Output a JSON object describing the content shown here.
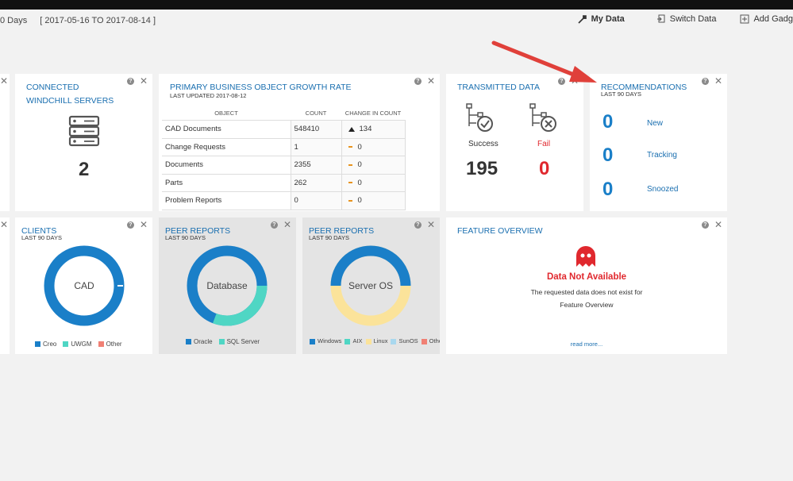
{
  "header": {
    "days_label": "0 Days",
    "date_range": "[ 2017-05-16 TO 2017-08-14 ]",
    "my_data": "My Data",
    "switch_data": "Switch Data",
    "add_gadget": "Add Gadg"
  },
  "connected": {
    "title_line1": "CONNECTED",
    "title_line2": "WINDCHILL SERVERS",
    "count": "2"
  },
  "growth": {
    "title": "PRIMARY BUSINESS OBJECT GROWTH RATE",
    "updated": "LAST UPDATED  2017-08-12",
    "columns": [
      "OBJECT",
      "COUNT",
      "CHANGE IN COUNT"
    ],
    "rows": [
      {
        "object": "CAD Documents",
        "count": "548410",
        "change": "134",
        "trend": "up"
      },
      {
        "object": "Change Requests",
        "count": "1",
        "change": "0",
        "trend": "flat"
      },
      {
        "object": "Documents",
        "count": "2355",
        "change": "0",
        "trend": "flat"
      },
      {
        "object": "Parts",
        "count": "262",
        "change": "0",
        "trend": "flat"
      },
      {
        "object": "Problem Reports",
        "count": "0",
        "change": "0",
        "trend": "flat"
      }
    ]
  },
  "transmitted": {
    "title": "TRANSMITTED DATA",
    "success_label": "Success",
    "success_count": "195",
    "fail_label": "Fail",
    "fail_count": "0"
  },
  "recommendations": {
    "title": "RECOMMENDATIONS",
    "subtitle": "LAST 90 DAYS",
    "items": [
      {
        "count": "0",
        "label": "New"
      },
      {
        "count": "0",
        "label": "Tracking"
      },
      {
        "count": "0",
        "label": "Snoozed"
      }
    ]
  },
  "clients": {
    "title": "CLIENTS",
    "subtitle": "LAST 90 DAYS",
    "center": "CAD",
    "legend": [
      "Creo",
      "UWGM",
      "Other"
    ]
  },
  "peer_db": {
    "title": "PEER REPORTS",
    "subtitle": "LAST 90 DAYS",
    "center": "Database",
    "legend": [
      "Oracle",
      "SQL Server"
    ]
  },
  "peer_os": {
    "title": "PEER REPORTS",
    "subtitle": "LAST 90 DAYS",
    "center": "Server OS",
    "legend": [
      "Windows",
      "AIX",
      "Linux",
      "SunOS",
      "Other"
    ]
  },
  "feature": {
    "title": "FEATURE OVERVIEW",
    "nodata_title": "Data Not Available",
    "nodata_line1": "The requested data does not exist for",
    "nodata_line2": "Feature Overview",
    "read_more": "read more..."
  },
  "colors": {
    "accent": "#1a6fb0",
    "blue": "#1a7fc8",
    "teal": "#4fd6c4",
    "yellow": "#fbe39a",
    "lightblue": "#a9d8ee",
    "salmon": "#f08074",
    "fail": "#e0282e",
    "arrow": "#e0403a"
  }
}
